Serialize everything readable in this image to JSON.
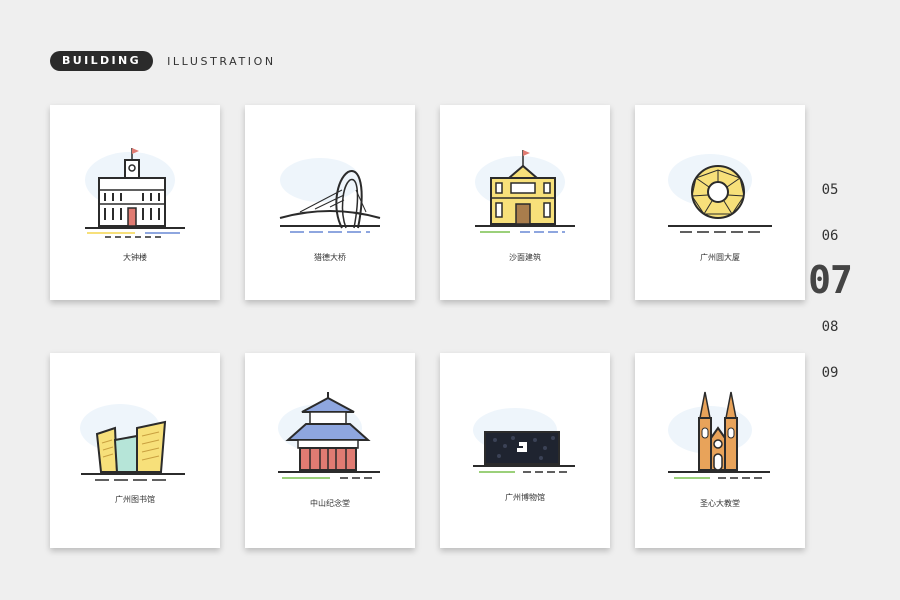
{
  "header": {
    "pill": "BUILDING",
    "subtitle": "ILLUSTRATION"
  },
  "cards": [
    {
      "caption": "大钟楼",
      "icon": "clock-tower-icon"
    },
    {
      "caption": "猎德大桥",
      "icon": "bridge-icon"
    },
    {
      "caption": "沙面建筑",
      "icon": "shamian-building-icon"
    },
    {
      "caption": "广州圆大厦",
      "icon": "circle-building-icon"
    },
    {
      "caption": "广州图书馆",
      "icon": "library-icon"
    },
    {
      "caption": "中山纪念堂",
      "icon": "memorial-hall-icon"
    },
    {
      "caption": "广州博物馆",
      "icon": "museum-icon"
    },
    {
      "caption": "圣心大教堂",
      "icon": "cathedral-icon"
    }
  ],
  "pager": {
    "pages": [
      "05",
      "06",
      "07",
      "08",
      "09"
    ],
    "active": "07"
  },
  "colors": {
    "background": "#efefef",
    "pill": "#2b2b2b",
    "yellow": "#f7e07a",
    "blue": "#8ea6df",
    "red": "#e07b72",
    "green": "#9bd07a",
    "dark": "#2b2b2b"
  }
}
